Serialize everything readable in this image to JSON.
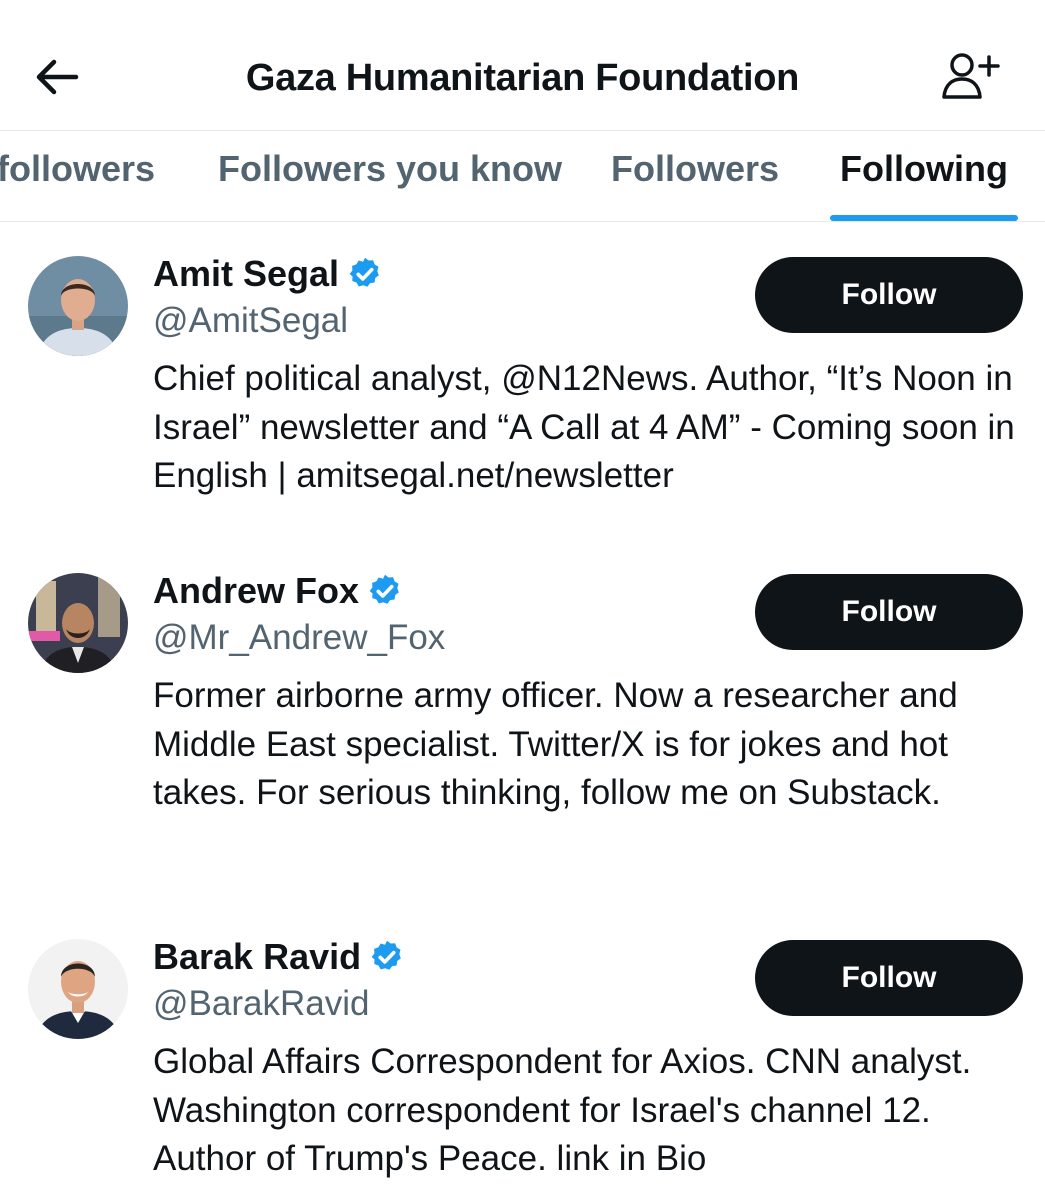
{
  "header": {
    "title": "Gaza Humanitarian Foundation",
    "back_icon": "arrow-left-icon",
    "action_icon": "add-person-icon"
  },
  "tabs": [
    {
      "label": "followers",
      "active": false
    },
    {
      "label": "Followers you know",
      "active": false
    },
    {
      "label": "Followers",
      "active": false
    },
    {
      "label": "Following",
      "active": true
    }
  ],
  "colors": {
    "accent": "#1d9bf0",
    "button_bg": "#0f1419",
    "secondary_text": "#536471"
  },
  "users": [
    {
      "name": "Amit Segal",
      "handle": "@AmitSegal",
      "verified": true,
      "follow_label": "Follow",
      "bio": "Chief political analyst, @N12News. Author, “It’s Noon in Israel” newsletter and “A Call at 4 AM” - Coming soon in English | amitsegal.net/newsletter"
    },
    {
      "name": "Andrew Fox",
      "handle": "@Mr_Andrew_Fox",
      "verified": true,
      "follow_label": "Follow",
      "bio": "Former airborne army officer. Now a researcher and Middle East specialist. Twitter/X is for jokes and hot takes. For serious thinking, follow me on Substack."
    },
    {
      "name": "Barak Ravid",
      "handle": "@BarakRavid",
      "verified": true,
      "follow_label": "Follow",
      "bio": "Global Affairs Correspondent for Axios. CNN analyst. Washington correspondent for Israel's channel 12. Author of Trump's Peace. link in Bio"
    }
  ]
}
